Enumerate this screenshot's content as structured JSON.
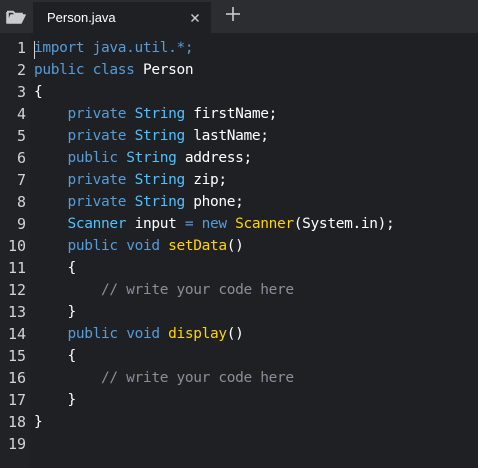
{
  "tab": {
    "title": "Person.java"
  },
  "icons": {
    "folder": "folder-open-icon",
    "close": "close-icon",
    "add": "plus-icon"
  },
  "colors": {
    "keyword": "#569cd6",
    "type": "#4fc1ff",
    "method": "#ffd500",
    "plain": "#ffffff",
    "comment": "#8a8f97",
    "punct": "#ffffff"
  },
  "editor": {
    "line_numbers": [
      "1",
      "2",
      "3",
      "4",
      "5",
      "6",
      "7",
      "8",
      "9",
      "10",
      "11",
      "12",
      "13",
      "14",
      "15",
      "16",
      "17",
      "18",
      "19"
    ],
    "lines": [
      [
        {
          "t": "import java.util.*;",
          "c": "keyword"
        }
      ],
      [
        {
          "t": "public class ",
          "c": "keyword"
        },
        {
          "t": "Person",
          "c": "plain"
        }
      ],
      [
        {
          "t": "{",
          "c": "plain"
        }
      ],
      [
        {
          "t": "    private ",
          "c": "keyword"
        },
        {
          "t": "String ",
          "c": "type"
        },
        {
          "t": "firstName;",
          "c": "plain"
        }
      ],
      [
        {
          "t": "    private ",
          "c": "keyword"
        },
        {
          "t": "String ",
          "c": "type"
        },
        {
          "t": "lastName;",
          "c": "plain"
        }
      ],
      [
        {
          "t": "    public ",
          "c": "keyword"
        },
        {
          "t": "String ",
          "c": "type"
        },
        {
          "t": "address;",
          "c": "plain"
        }
      ],
      [
        {
          "t": "    private ",
          "c": "keyword"
        },
        {
          "t": "String ",
          "c": "type"
        },
        {
          "t": "zip;",
          "c": "plain"
        }
      ],
      [
        {
          "t": "    private ",
          "c": "keyword"
        },
        {
          "t": "String ",
          "c": "type"
        },
        {
          "t": "phone;",
          "c": "plain"
        }
      ],
      [
        {
          "t": "    Scanner ",
          "c": "type"
        },
        {
          "t": "input ",
          "c": "plain"
        },
        {
          "t": "= new ",
          "c": "keyword"
        },
        {
          "t": "Scanner",
          "c": "method"
        },
        {
          "t": "(System.in);",
          "c": "plain"
        }
      ],
      [
        {
          "t": "    public ",
          "c": "keyword"
        },
        {
          "t": "void ",
          "c": "keyword"
        },
        {
          "t": "setData",
          "c": "method"
        },
        {
          "t": "()",
          "c": "plain"
        }
      ],
      [
        {
          "t": "    {",
          "c": "plain"
        }
      ],
      [
        {
          "t": "        // write your code here",
          "c": "comment"
        }
      ],
      [
        {
          "t": "    }",
          "c": "plain"
        }
      ],
      [
        {
          "t": "    public ",
          "c": "keyword"
        },
        {
          "t": "void ",
          "c": "keyword"
        },
        {
          "t": "display",
          "c": "method"
        },
        {
          "t": "()",
          "c": "plain"
        }
      ],
      [
        {
          "t": "    {",
          "c": "plain"
        }
      ],
      [
        {
          "t": "        // write your code here",
          "c": "comment"
        }
      ],
      [
        {
          "t": "    }",
          "c": "plain"
        }
      ],
      [
        {
          "t": "}",
          "c": "plain"
        }
      ],
      []
    ]
  }
}
